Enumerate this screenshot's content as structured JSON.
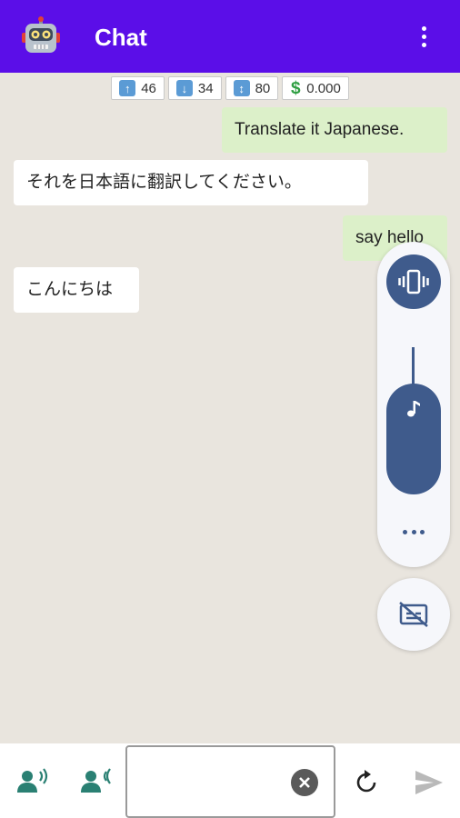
{
  "app": {
    "title": "Chat",
    "accent_color": "#5b0ee8"
  },
  "stats": [
    {
      "icon": "arrow-up-icon",
      "value": "46"
    },
    {
      "icon": "arrow-down-icon",
      "value": "34"
    },
    {
      "icon": "arrow-up-down-icon",
      "value": "80"
    },
    {
      "icon": "dollar-icon",
      "value": "0.000"
    }
  ],
  "messages": [
    {
      "role": "user",
      "text": "Translate it Japanese."
    },
    {
      "role": "assistant",
      "text": "それを日本語に翻訳してください。"
    },
    {
      "role": "user",
      "text": "say hello"
    },
    {
      "role": "assistant",
      "text": "こんにちは"
    }
  ],
  "input": {
    "value": "",
    "placeholder": ""
  },
  "icons": {
    "app": "robot-icon",
    "menu": "more-vert-icon",
    "vibrate": "vibrate-icon",
    "music": "music-note-icon",
    "more": "more-horiz-icon",
    "captions_off": "captions-off-icon",
    "voice_left": "record-voice-icon",
    "voice_right": "voice-listen-icon",
    "clear": "clear-icon",
    "refresh": "refresh-icon",
    "send": "send-icon"
  },
  "volume_level": 0.45
}
